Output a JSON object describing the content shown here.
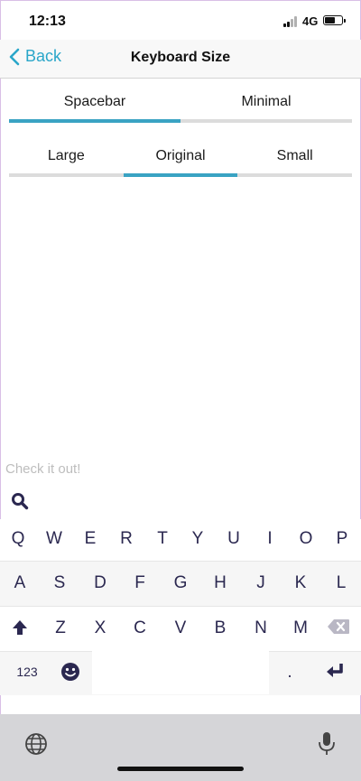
{
  "status": {
    "time": "12:13",
    "network": "4G"
  },
  "nav": {
    "back_label": "Back",
    "title": "Keyboard Size"
  },
  "style_tabs": [
    {
      "label": "Spacebar",
      "active": true
    },
    {
      "label": "Minimal",
      "active": false
    }
  ],
  "size_tabs": [
    {
      "label": "Large",
      "active": false
    },
    {
      "label": "Original",
      "active": true
    },
    {
      "label": "Small",
      "active": false
    }
  ],
  "preview": {
    "text": "Check it out!"
  },
  "keyboard": {
    "row1": [
      "Q",
      "W",
      "E",
      "R",
      "T",
      "Y",
      "U",
      "I",
      "O",
      "P"
    ],
    "row2": [
      "A",
      "S",
      "D",
      "F",
      "G",
      "H",
      "J",
      "K",
      "L"
    ],
    "row3": [
      "Z",
      "X",
      "C",
      "V",
      "B",
      "N",
      "M"
    ],
    "numbers_label": "123",
    "period_label": "."
  },
  "colors": {
    "accent": "#2aa6c9",
    "tab_active": "#3aa3c3",
    "key_text": "#2b2850"
  },
  "icons": [
    "search-icon",
    "shift-icon",
    "backspace-icon",
    "emoji-icon",
    "return-icon",
    "globe-icon",
    "microphone-icon",
    "chevron-left-icon"
  ]
}
